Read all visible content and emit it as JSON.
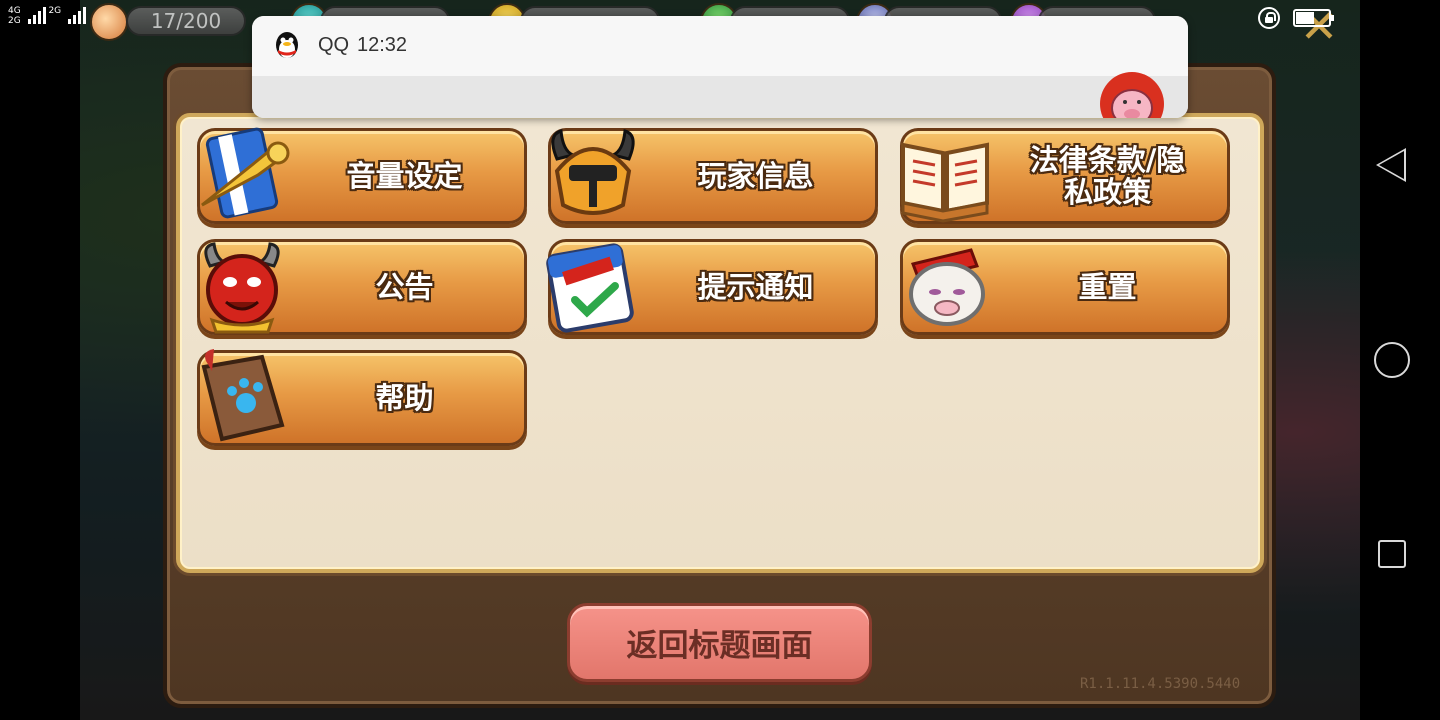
{
  "status_bar": {
    "network_top": "4G",
    "network_bottom": "2G",
    "network_right": "2G"
  },
  "resources": {
    "stamina": "17/200"
  },
  "notification": {
    "app_name": "QQ",
    "time": "12:32",
    "avatar_icon": "pig-avatar-icon",
    "app_icon": "qq-penguin-icon"
  },
  "menu": {
    "items": [
      {
        "label": "音量设定",
        "icon": "trumpet-banner-icon"
      },
      {
        "label": "玩家信息",
        "icon": "horned-helmet-icon"
      },
      {
        "label": "法律条款/隐\n私政策",
        "icon": "open-book-icon"
      },
      {
        "label": "公告",
        "icon": "red-devil-icon"
      },
      {
        "label": "提示通知",
        "icon": "hello-calendar-icon"
      },
      {
        "label": "重置",
        "icon": "sheep-icon"
      },
      {
        "label": "帮助",
        "icon": "paw-book-icon"
      }
    ]
  },
  "return_button": "返回标题画面",
  "version": "R1.1.11.4.5390.5440",
  "colors": {
    "menu_button": "#e79a45",
    "return_button": "#ef857b",
    "panel": "#f1e6d2",
    "frame": "#5b402a"
  }
}
